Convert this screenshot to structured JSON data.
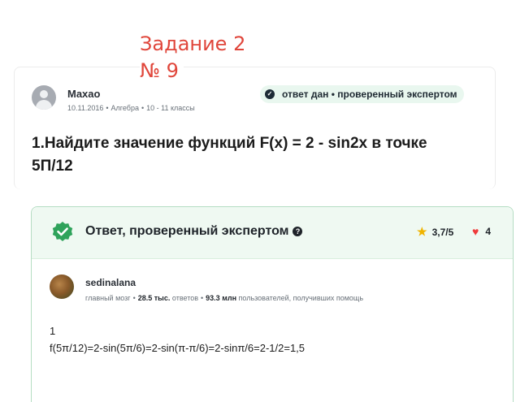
{
  "annotation": {
    "line1": "Задание 2",
    "line2": "№ 9"
  },
  "question": {
    "author": "Maxao",
    "date": "10.11.2016",
    "subject": "Алгебра",
    "grade": "10 - 11 классы",
    "verified_label": "ответ дан • проверенный экспертом",
    "text": "1.Найдите значение функций F(x) = 2 - sin2x в точке 5П/12"
  },
  "answer": {
    "title": "Ответ, проверенный экспертом",
    "rating": "3,7/5",
    "likes": "4",
    "author": "sedinalana",
    "rank": "главный мозг",
    "answers_count": "28.5 тыс.",
    "answers_label": "ответов",
    "helped_count": "93.3 млн",
    "helped_label": "пользователей, получивших помощь",
    "body_line1": "1",
    "body_line2": "f(5π/12)=2-sin(5π/6)=2-sin(π-π/6)=2-sinπ/6=2-1/2=1,5"
  },
  "colors": {
    "annotation": "#e0463b",
    "brand_green": "#2fa35b",
    "star": "#f0b400",
    "heart": "#ef3b3b"
  },
  "icons": {
    "verified": "check-badge-icon",
    "star": "star-icon",
    "heart": "heart-icon",
    "help": "question-icon"
  }
}
